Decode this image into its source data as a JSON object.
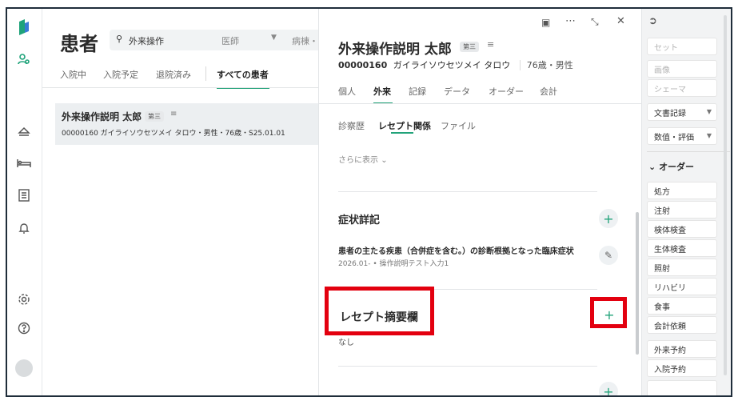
{
  "page": {
    "title": "患者",
    "search_value": "外来操作",
    "filter_doctor": "医師",
    "filter_ward": "病棟・",
    "tabs": [
      "入院中",
      "入院予定",
      "退院済み",
      "すべての患者"
    ]
  },
  "list_row": {
    "name": "外来操作説明 太郎",
    "badge": "第三",
    "detail": "00000160 ガイライソウセツメイ タロウ・男性・76歳・S25.01.01"
  },
  "detail": {
    "name": "外来操作説明 太郎",
    "badge": "第三",
    "id": "00000160",
    "kana": "ガイライソウセツメイ タロウ",
    "age_sex": "76歳・男性",
    "tabs": [
      "個人",
      "外来",
      "記録",
      "データ",
      "オーダー",
      "会計"
    ],
    "subtabs": [
      "診察歴",
      "レセプト関係",
      "ファイル"
    ],
    "show_more": "さらに表示",
    "symptom_title": "症状詳記",
    "symptom_desc": "患者の主たる疾患（合併症を含む。）の診断根拠となった臨床症状",
    "symptom_sub": "2026.01- • 操作説明テスト入力1",
    "receipt_title": "レセプト摘要欄",
    "receipt_value": "なし"
  },
  "sidebar": {
    "top_items": [
      "セット",
      "画像",
      "シェーマ"
    ],
    "dropdowns": [
      "文書記録",
      "数值・評価"
    ],
    "order_header": "オーダー",
    "order_items": [
      "処方",
      "注射",
      "検体検査",
      "生体検査",
      "照射",
      "リハビリ",
      "食事",
      "会計依頼"
    ],
    "booking_items": [
      "外来予約",
      "入院予約"
    ]
  },
  "colors": {
    "accent": "#22a37a",
    "highlight": "#e3000f",
    "list_selected": "#eceff1",
    "sidebar_bg": "#f2f3f4"
  },
  "icons": {
    "logo": "brand-logo-icon",
    "rail": [
      "patients-icon",
      "eject-icon",
      "bed-icon",
      "list-icon",
      "bell-icon",
      "gear-icon",
      "help-icon",
      "avatar"
    ]
  }
}
